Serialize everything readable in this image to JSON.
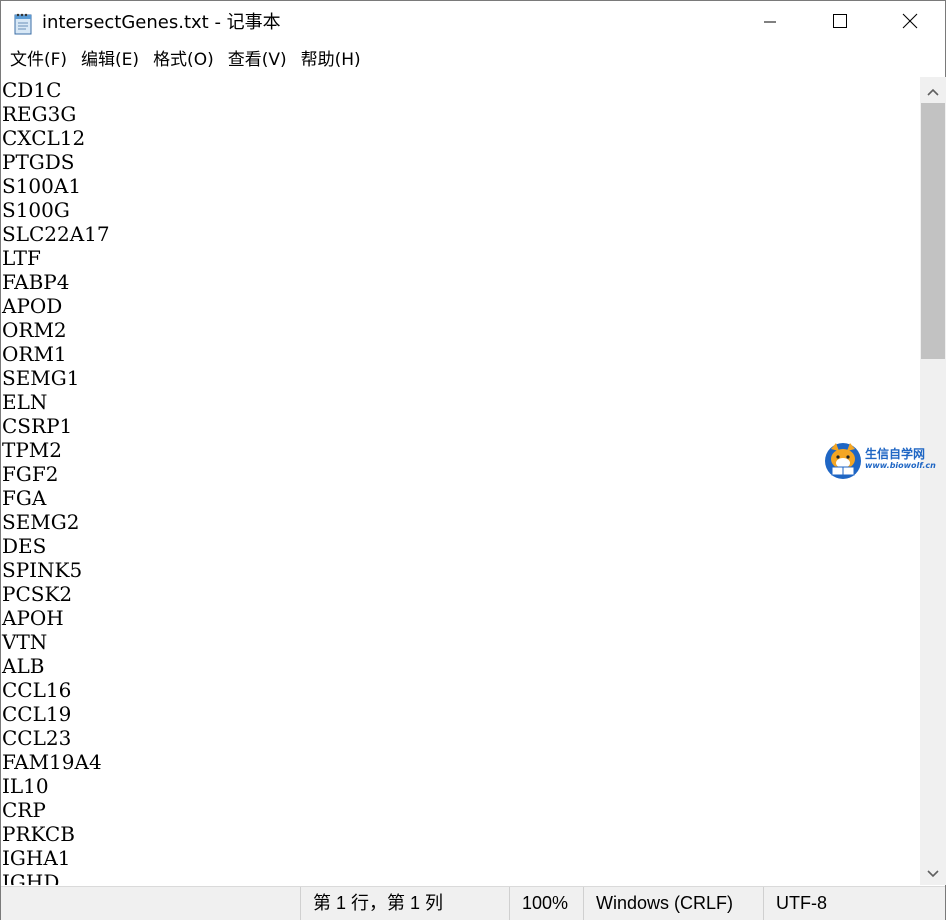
{
  "window": {
    "title": "intersectGenes.txt - 记事本",
    "icon": "notepad-icon",
    "controls": [
      "minimize-icon",
      "maximize-icon",
      "close-icon"
    ]
  },
  "menu": [
    {
      "label": "文件(F)"
    },
    {
      "label": "编辑(E)"
    },
    {
      "label": "格式(O)"
    },
    {
      "label": "查看(V)"
    },
    {
      "label": "帮助(H)"
    }
  ],
  "editor": {
    "lines": [
      "CD1C",
      "REG3G",
      "CXCL12",
      "PTGDS",
      "S100A1",
      "S100G",
      "SLC22A17",
      "LTF",
      "FABP4",
      "APOD",
      "ORM2",
      "ORM1",
      "SEMG1",
      "ELN",
      "CSRP1",
      "TPM2",
      "FGF2",
      "FGA",
      "SEMG2",
      "DES",
      "SPINK5",
      "PCSK2",
      "APOH",
      "VTN",
      "ALB",
      "CCL16",
      "CCL19",
      "CCL23",
      "FAM19A4",
      "IL10",
      "CRP",
      "PRKCB",
      "IGHA1",
      "IGHD"
    ]
  },
  "statusbar": {
    "position": "第 1 行，第 1 列",
    "zoom": "100%",
    "line_ending": "Windows (CRLF)",
    "encoding": "UTF-8"
  },
  "watermark": {
    "title": "生信自学网",
    "url": "www.biowolf.cn"
  },
  "colors": {
    "scroll_thumb": "#c2c2c2",
    "statusbar_bg": "#f0f0f0",
    "watermark_blue": "#1f66c4",
    "watermark_orange": "#f5a623"
  }
}
